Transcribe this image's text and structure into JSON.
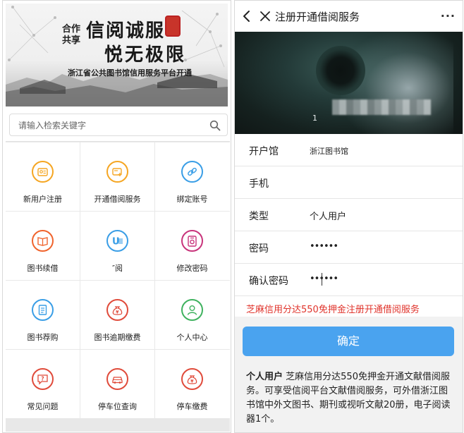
{
  "left": {
    "banner": {
      "stamp_lines": [
        "合作",
        "共享"
      ],
      "title_line1": "信阅诚服",
      "title_line2": "悦无极限",
      "subtitle": "浙江省公共图书馆信用服务平台开通"
    },
    "search": {
      "placeholder": "请输入检索关键字"
    },
    "grid": [
      {
        "label": "新用户注册",
        "icon": "id-card-icon",
        "color": "#f5a623"
      },
      {
        "label": "开通借阅服务",
        "icon": "card-plus-icon",
        "color": "#f5a623"
      },
      {
        "label": "绑定账号",
        "icon": "link-icon",
        "color": "#3a9ee6"
      },
      {
        "label": "图书续借",
        "icon": "book-icon",
        "color": "#f0642d"
      },
      {
        "label": "″阅",
        "icon": "u-brand-icon",
        "color": "#3a9ee6"
      },
      {
        "label": "修改密码",
        "icon": "lock-icon",
        "color": "#c8347b"
      },
      {
        "label": "图书荐购",
        "icon": "document-icon",
        "color": "#3a9ee6"
      },
      {
        "label": "图书逾期缴费",
        "icon": "money-bag-icon",
        "color": "#e04b3b"
      },
      {
        "label": "个人中心",
        "icon": "person-icon",
        "color": "#3fb25f"
      },
      {
        "label": "常见问题",
        "icon": "question-icon",
        "color": "#e04b3b"
      },
      {
        "label": "停车位查询",
        "icon": "car-icon",
        "color": "#e04b3b"
      },
      {
        "label": "停车缴费",
        "icon": "money-bag-icon",
        "color": "#e04b3b"
      }
    ]
  },
  "right": {
    "nav": {
      "title": "注册开通借阅服务",
      "more": "···"
    },
    "cover": {
      "text": "1"
    },
    "form": {
      "library": {
        "label": "开户馆",
        "value": "浙江图书馆"
      },
      "phone": {
        "label": "手机",
        "value": ""
      },
      "type": {
        "label": "类型",
        "value": "个人用户"
      },
      "password": {
        "label": "密码",
        "value": "••••••"
      },
      "confirm_password": {
        "label": "确认密码",
        "value": "••••••"
      }
    },
    "promo": "芝麻信用分达550免押金注册开通借阅服务",
    "confirm_button": "确定",
    "description": {
      "bold": "个人用户",
      "text": " 芝麻信用分达550免押金开通文献借阅服务。可享受信阅平台文献借阅服务，可外借浙江图书馆中外文图书、期刊或视听文献20册，电子阅读器1个。"
    }
  }
}
